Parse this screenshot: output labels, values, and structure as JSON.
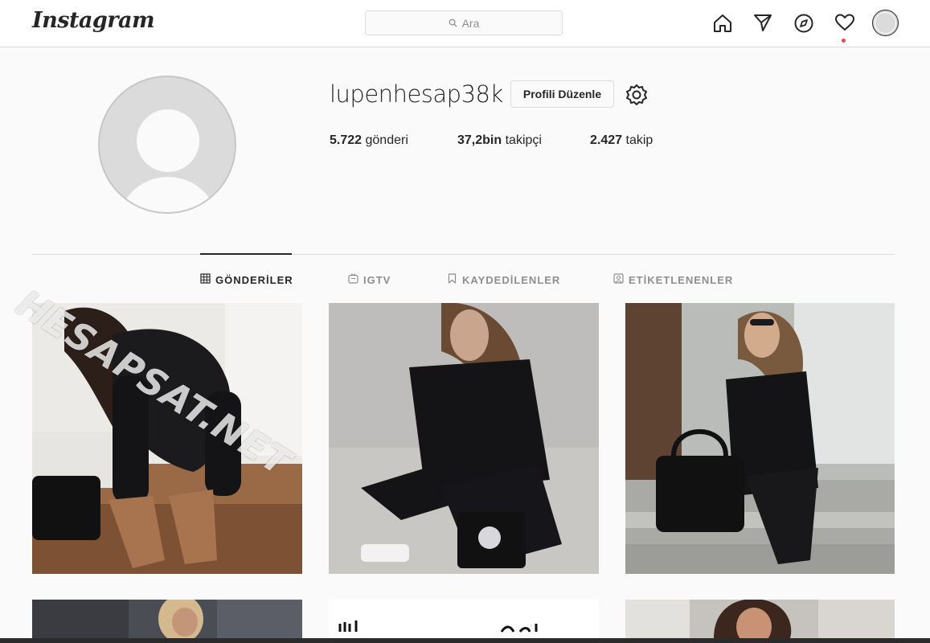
{
  "brand": {
    "logo_text": "Instagram"
  },
  "search": {
    "placeholder": "Ara"
  },
  "nav": {
    "icons": [
      "home-icon",
      "direct-icon",
      "explore-icon",
      "activity-icon",
      "profile-avatar"
    ],
    "notification_dot_color": "#ed4956"
  },
  "profile": {
    "username": "lupenhesap38k",
    "edit_label": "Profili Düzenle",
    "stats": [
      {
        "value": "5.722",
        "label": "gönderi"
      },
      {
        "value": "37,2bin",
        "label": "takipçi"
      },
      {
        "value": "2.427",
        "label": "takip"
      }
    ]
  },
  "tabs": [
    {
      "label": "GÖNDERİLER",
      "icon": "grid-icon",
      "active": true
    },
    {
      "label": "IGTV",
      "icon": "tv-icon",
      "active": false
    },
    {
      "label": "KAYDEDİLENLER",
      "icon": "bookmark-icon",
      "active": false
    },
    {
      "label": "ETİKETLENENLER",
      "icon": "tag-icon",
      "active": false
    }
  ],
  "watermark": "HESAPSAT.NET",
  "posts": [
    {
      "name": "post-black-sweater-heels"
    },
    {
      "name": "post-black-suit-bag"
    },
    {
      "name": "post-stairs-black-bag"
    },
    {
      "name": "post-street-blonde"
    },
    {
      "name": "post-white-text"
    },
    {
      "name": "post-brunette-portrait"
    }
  ],
  "colors": {
    "border": "#dbdbdb",
    "text": "#262626",
    "muted": "#8e8e8e",
    "background": "#fafafa"
  }
}
